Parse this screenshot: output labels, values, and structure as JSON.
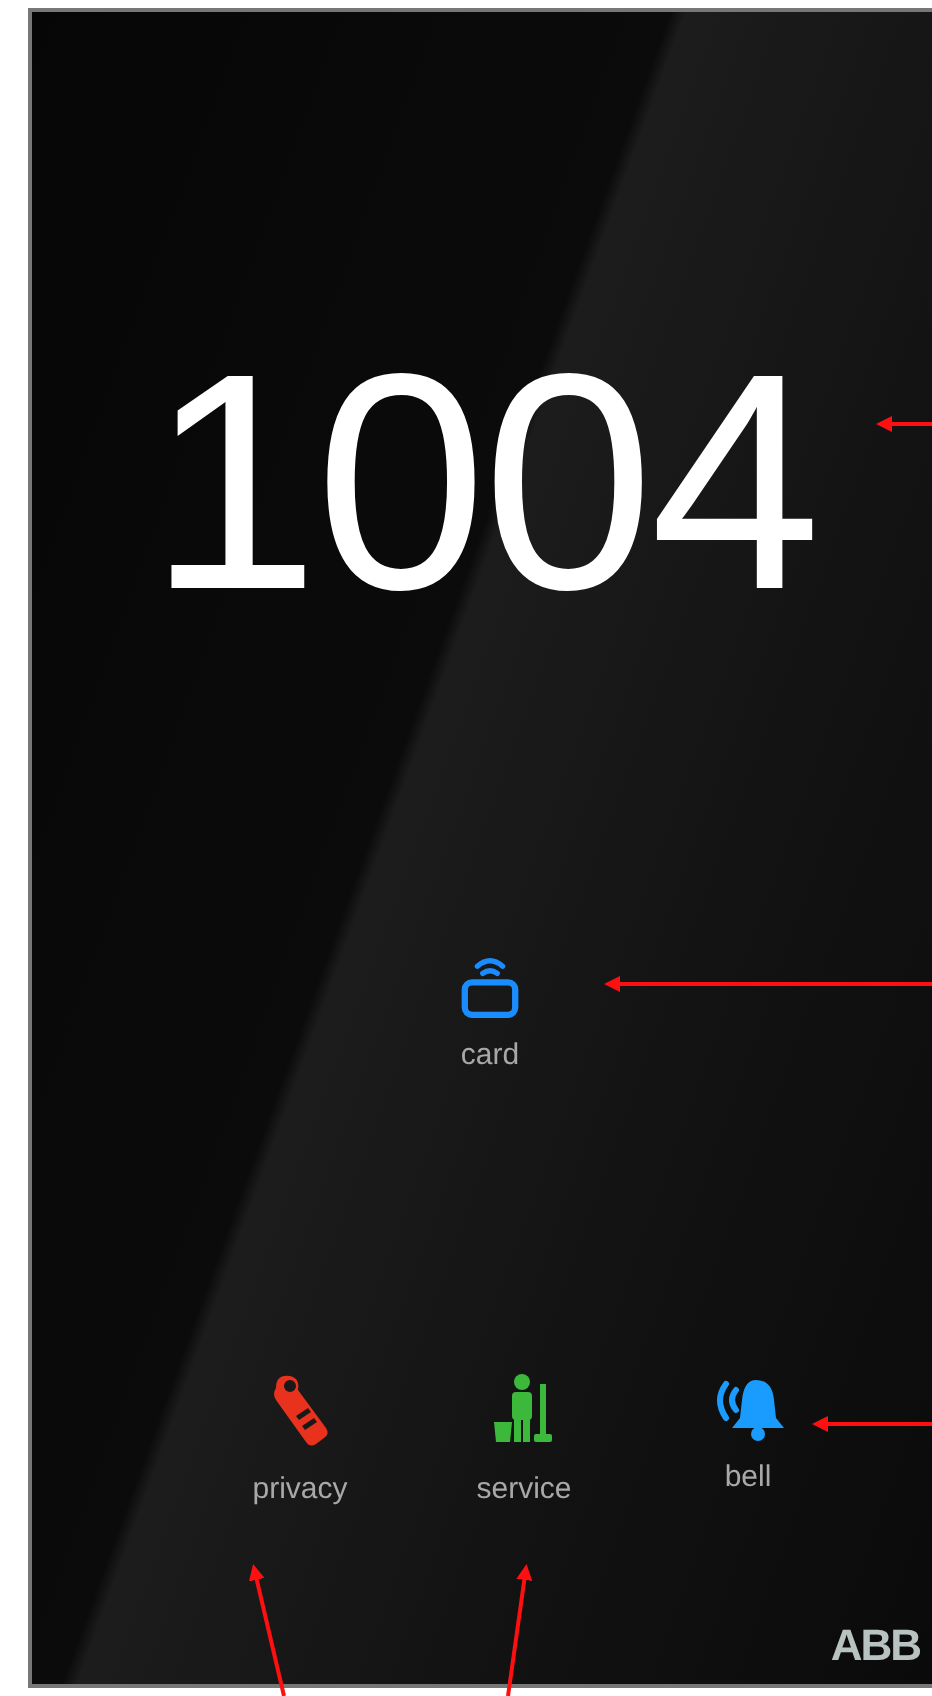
{
  "room_number": "1004",
  "main_indicator": {
    "kind": "card",
    "label": "card",
    "color": "#1a8cff"
  },
  "indicators": [
    {
      "kind": "privacy",
      "label": "privacy",
      "color": "#e8321e"
    },
    {
      "kind": "service",
      "label": "service",
      "color": "#3cb83a"
    },
    {
      "kind": "bell",
      "label": "bell",
      "color": "#1a9cff"
    }
  ],
  "logo": "ABB"
}
